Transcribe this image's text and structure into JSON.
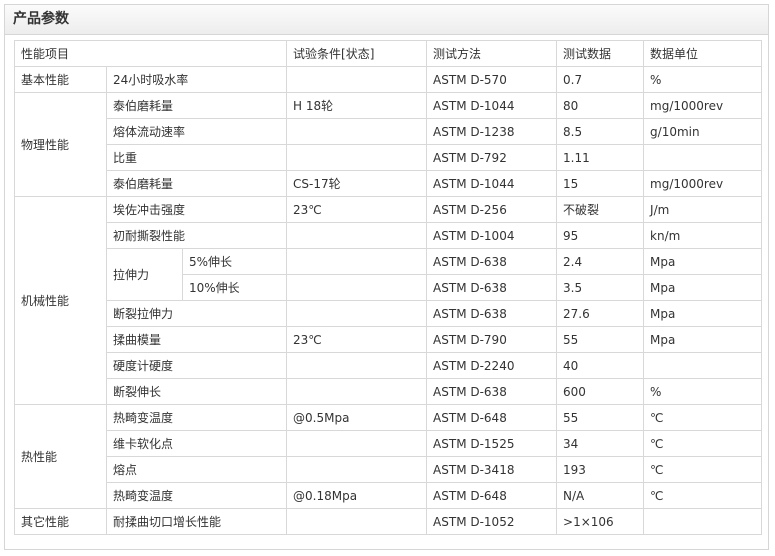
{
  "panel": {
    "title": "产品参数"
  },
  "headers": {
    "item": "性能项目",
    "condition": "试验条件[状态]",
    "method": "测试方法",
    "value": "测试数据",
    "unit": "数据单位"
  },
  "basic": {
    "category": "基本性能",
    "rows": [
      {
        "name": "24小时吸水率",
        "condition": "",
        "method": "ASTM D-570",
        "value": "0.7",
        "unit": "%"
      }
    ]
  },
  "physical": {
    "category": "物理性能",
    "rows": [
      {
        "name": "泰伯磨耗量",
        "condition": "H 18轮",
        "method": "ASTM D-1044",
        "value": "80",
        "unit": "mg/1000rev"
      },
      {
        "name": "熔体流动速率",
        "condition": "",
        "method": "ASTM D-1238",
        "value": "8.5",
        "unit": "g/10min"
      },
      {
        "name": "比重",
        "condition": "",
        "method": "ASTM D-792",
        "value": "1.11",
        "unit": ""
      },
      {
        "name": "泰伯磨耗量",
        "condition": "CS-17轮",
        "method": "ASTM D-1044",
        "value": "15",
        "unit": "mg/1000rev"
      }
    ]
  },
  "mechanical": {
    "category": "机械性能",
    "impact": {
      "name": "埃佐冲击强度",
      "condition": "23℃",
      "method": "ASTM D-256",
      "value": "不破裂",
      "unit": "J/m"
    },
    "tear": {
      "name": "初耐撕裂性能",
      "condition": "",
      "method": "ASTM D-1004",
      "value": "95",
      "unit": "kn/m"
    },
    "tensile": {
      "name": "拉伸力",
      "sub": [
        {
          "name": "5%伸长",
          "condition": "",
          "method": "ASTM D-638",
          "value": "2.4",
          "unit": "Mpa"
        },
        {
          "name": "10%伸长",
          "condition": "",
          "method": "ASTM D-638",
          "value": "3.5",
          "unit": "Mpa"
        }
      ]
    },
    "break_tensile": {
      "name": "断裂拉伸力",
      "condition": "",
      "method": "ASTM D-638",
      "value": "27.6",
      "unit": "Mpa"
    },
    "flex_modulus": {
      "name": "揉曲模量",
      "condition": "23℃",
      "method": "ASTM D-790",
      "value": "55",
      "unit": "Mpa"
    },
    "hardness": {
      "name": "硬度计硬度",
      "condition": "",
      "method": "ASTM D-2240",
      "value": "40",
      "unit": ""
    },
    "elongation": {
      "name": "断裂伸长",
      "condition": "",
      "method": "ASTM D-638",
      "value": "600",
      "unit": "%"
    }
  },
  "thermal": {
    "category": "热性能",
    "rows": [
      {
        "name": "热畸变温度",
        "condition": "@0.5Mpa",
        "method": "ASTM D-648",
        "value": "55",
        "unit": "℃"
      },
      {
        "name": "维卡软化点",
        "condition": "",
        "method": "ASTM D-1525",
        "value": "34",
        "unit": "℃"
      },
      {
        "name": "熔点",
        "condition": "",
        "method": "ASTM D-3418",
        "value": "193",
        "unit": "℃"
      },
      {
        "name": "热畸变温度",
        "condition": "@0.18Mpa",
        "method": "ASTM D-648",
        "value": "N/A",
        "unit": "℃"
      }
    ]
  },
  "other": {
    "category": "其它性能",
    "rows": [
      {
        "name": "耐揉曲切口增长性能",
        "condition": "",
        "method": "ASTM D-1052",
        "value": ">1×106",
        "unit": ""
      }
    ]
  }
}
